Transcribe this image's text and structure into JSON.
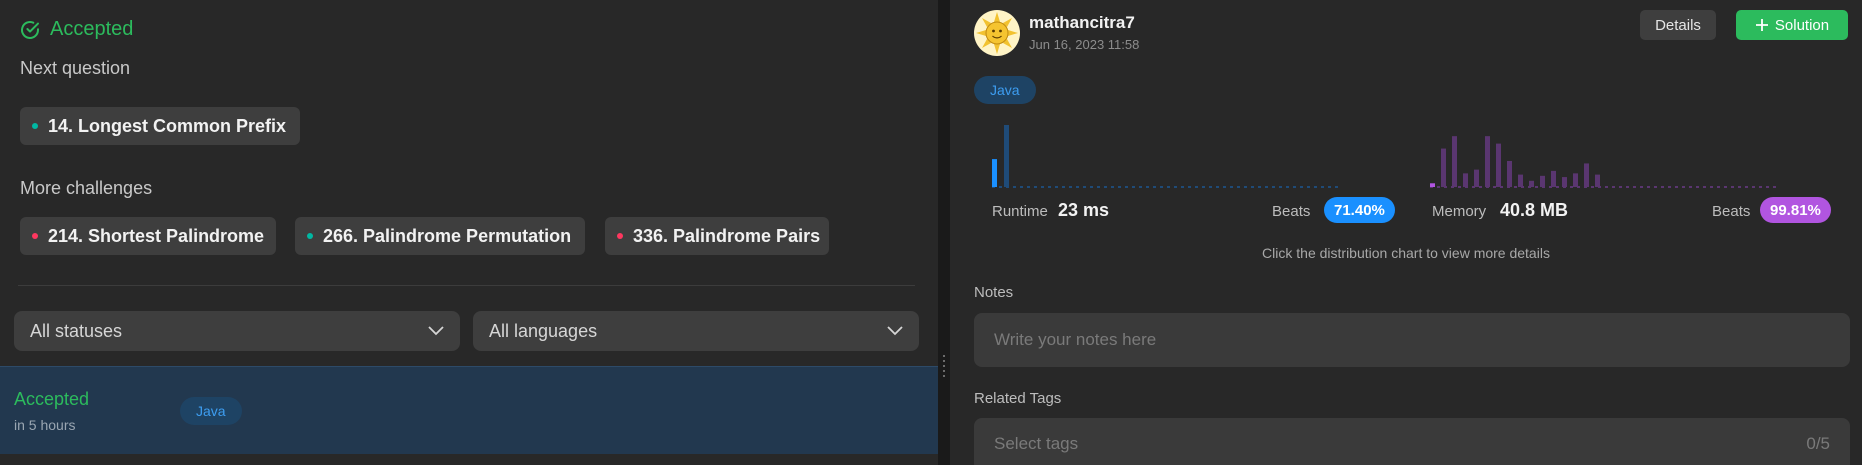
{
  "left": {
    "status_title": "Accepted",
    "next_question": {
      "heading": "Next question",
      "item": {
        "label": "14. Longest Common Prefix",
        "difficulty": "easy"
      }
    },
    "more_challenges": {
      "heading": "More challenges",
      "items": [
        {
          "label": "214. Shortest Palindrome",
          "difficulty": "hard"
        },
        {
          "label": "266. Palindrome Permutation",
          "difficulty": "easy"
        },
        {
          "label": "336. Palindrome Pairs",
          "difficulty": "hard"
        }
      ]
    },
    "filters": {
      "status": "All statuses",
      "language": "All languages"
    },
    "submission": {
      "status": "Accepted",
      "time": "in 5 hours",
      "language": "Java"
    }
  },
  "right": {
    "user": {
      "name": "mathancitra7",
      "date": "Jun 16, 2023 11:58"
    },
    "buttons": {
      "details": "Details",
      "solution": "Solution"
    },
    "language": "Java",
    "runtime": {
      "label": "Runtime",
      "value": "23 ms",
      "beats_label": "Beats",
      "beats_value": "71.40%",
      "bars": [
        0.45,
        1.0
      ],
      "highlight_index": 0
    },
    "memory": {
      "label": "Memory",
      "value": "40.8 MB",
      "beats_label": "Beats",
      "beats_value": "99.81%",
      "bars": [
        0.06,
        0.62,
        0.82,
        0.22,
        0.28,
        0.82,
        0.7,
        0.42,
        0.2,
        0.1,
        0.18,
        0.26,
        0.16,
        0.22,
        0.38,
        0.2
      ],
      "highlight_index": 0
    },
    "hint": "Click the distribution chart to view more details",
    "notes": {
      "label": "Notes",
      "placeholder": "Write your notes here"
    },
    "tags": {
      "label": "Related Tags",
      "placeholder": "Select tags",
      "count": "0/5"
    },
    "colors": {
      "accepted": "#2cbb5d",
      "runtime_badge": "#1a90ff",
      "memory_badge": "#b155e0",
      "runtime_bar": "#1f4b78",
      "memory_bar": "#5a3670"
    }
  }
}
